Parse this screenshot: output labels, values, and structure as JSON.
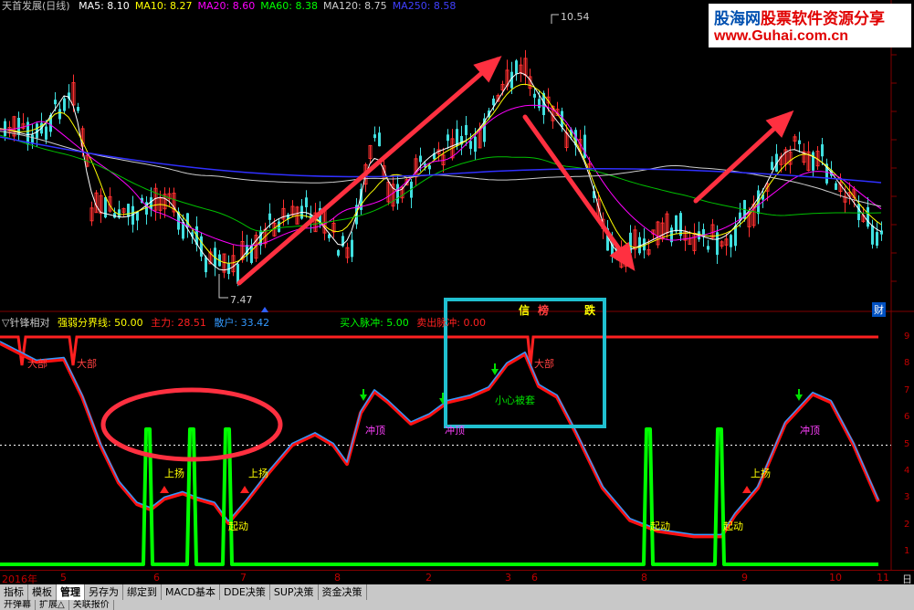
{
  "header": {
    "title": "天首发展(日线)",
    "ma": [
      {
        "label": "MA5: 8.10",
        "color": "#ffffff"
      },
      {
        "label": "MA10: 8.27",
        "color": "#ffff00"
      },
      {
        "label": "MA20: 8.60",
        "color": "#ff00ff"
      },
      {
        "label": "MA60: 8.38",
        "color": "#00ff00"
      },
      {
        "label": "MA120: 8.75",
        "color": "#cccccc"
      },
      {
        "label": "MA250: 8.58",
        "color": "#4040ff"
      }
    ]
  },
  "logo": {
    "line1a": "股海网",
    "line1b": "股票软件资源分享",
    "line2": "www.Guhai.com.cn"
  },
  "price": {
    "high_label": "10.54",
    "low_label": "7.47",
    "right_marker": "财"
  },
  "indicator": {
    "name": "▽针锋相对",
    "threshold": "强弱分界线: 50.00",
    "main_force": "主力: 28.51",
    "retail": "散户: 33.42",
    "buy_pulse": "买入脉冲: 5.00",
    "sell_pulse": "卖出脉冲: 0.00",
    "box_labels": [
      "信",
      "榜",
      "跌"
    ],
    "signals": {
      "top1": "大部",
      "top2": "大部",
      "top3": "大部",
      "rise1": "上扬",
      "rise2": "上扬",
      "rise3": "上扬",
      "start1": "起动",
      "start2": "起动",
      "start3": "起动",
      "peak1": "冲顶",
      "peak2": "冲顶",
      "peak3": "冲顶",
      "caution": "小心被套"
    },
    "y_ticks": [
      "9",
      "8",
      "7",
      "6",
      "5",
      "4",
      "3",
      "2",
      "1"
    ]
  },
  "x_axis": {
    "labels": [
      "2016年",
      "5",
      "6",
      "7",
      "8",
      "2",
      "3",
      "6",
      "8",
      "9",
      "10",
      "11",
      "日"
    ]
  },
  "tabs": [
    "指标",
    "模板",
    "管理",
    "另存为",
    "绑定到",
    "MACD基本",
    "DDE决策",
    "SUP决策",
    "资金决策"
  ],
  "active_tab": "管理",
  "tabs2": [
    "开弹幕",
    "扩展△",
    "关联报价"
  ],
  "chart_data": {
    "type": "line",
    "series": [
      {
        "name": "主力",
        "color": "#ff0000"
      },
      {
        "name": "散户",
        "color": "#3399ff"
      },
      {
        "name": "买入脉冲",
        "color": "#00ff00"
      }
    ],
    "ylim": [
      0,
      10
    ],
    "threshold": 5
  }
}
